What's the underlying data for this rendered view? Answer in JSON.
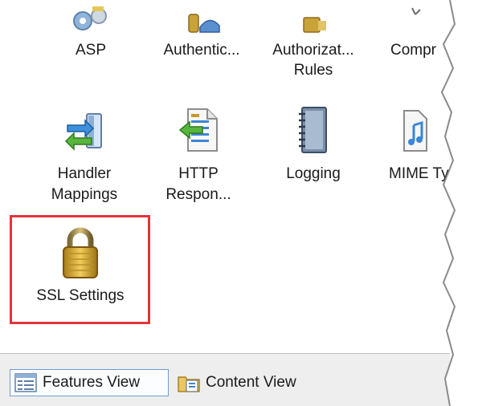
{
  "features": [
    {
      "id": "asp",
      "label_lines": [
        "ASP"
      ],
      "icon": "gears-icon"
    },
    {
      "id": "authentication",
      "label_lines": [
        "Authentic..."
      ],
      "icon": "users-key-icon"
    },
    {
      "id": "authorization-rules",
      "label_lines": [
        "Authorizat...",
        "Rules"
      ],
      "icon": "authorization-icon"
    },
    {
      "id": "compression",
      "label_lines": [
        "Compr"
      ],
      "icon": "compression-icon"
    },
    {
      "id": "handler-mappings",
      "label_lines": [
        "Handler",
        "Mappings"
      ],
      "icon": "handler-arrows-icon"
    },
    {
      "id": "http-response-headers",
      "label_lines": [
        "HTTP",
        "Respon..."
      ],
      "icon": "http-response-icon"
    },
    {
      "id": "logging",
      "label_lines": [
        "Logging"
      ],
      "icon": "notebook-icon"
    },
    {
      "id": "mime-types",
      "label_lines": [
        "MIME Ty"
      ],
      "icon": "music-file-icon"
    },
    {
      "id": "ssl-settings",
      "label_lines": [
        "SSL Settings"
      ],
      "icon": "padlock-icon"
    }
  ],
  "bottom_tabs": [
    {
      "label": "Features View",
      "active": true,
      "icon": "features-view-icon"
    },
    {
      "label": "Content View",
      "active": false,
      "icon": "content-view-icon"
    }
  ],
  "colors": {
    "highlight": "#e3333a",
    "active_tab_border": "#6f9bd1"
  }
}
